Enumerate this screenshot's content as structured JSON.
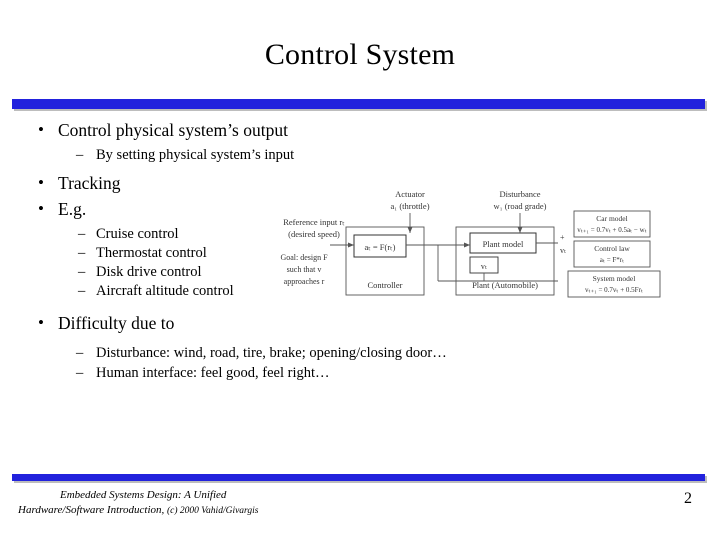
{
  "slide": {
    "title": "Control System",
    "page_number": "2",
    "accent_color": "#2222dd",
    "bullets": {
      "b1_1": "Control physical system’s output",
      "b2_1": "By setting physical system’s input",
      "b1_2": "Tracking",
      "b1_3": "E.g.",
      "b2_2": "Cruise control",
      "b2_3": "Thermostat control",
      "b2_4": "Disk drive control",
      "b2_5": "Aircraft altitude control",
      "b1_4": "Difficulty due to",
      "b2_6": "Disturbance: wind, road, tire, brake; opening/closing door…",
      "b2_7": "Human interface: feel good, feel right…"
    },
    "diagram": {
      "actuator_label_1": "Actuator",
      "actuator_label_2": "a₁ (throttle)",
      "disturbance_label_1": "Disturbance",
      "disturbance_label_2": "w₁ (road grade)",
      "reference_label_1": "Reference input rₜ",
      "reference_label_2": "(desired speed)",
      "goal_label_1": "Goal: design F",
      "goal_label_2": "such that v",
      "goal_label_3": "approaches r",
      "controller_box": "Controller",
      "formula_box": "aₜ = F(rₜ)",
      "plant_box": "Plant model",
      "plant_inner": "vₜ",
      "plant_auto_box": "Plant (Automobile)",
      "car_model_title": "Car model",
      "car_model_eq": "vₜ₊₁ = 0.7vₜ + 0.5aₜ − wₜ",
      "control_law_title": "Control law",
      "control_law_eq": "aₜ = F*rₜ",
      "system_model_title": "System model",
      "system_model_eq": "vₜ₊₁ = 0.7vₜ + 0.5Frₜ",
      "sum_symbol": "+",
      "output_symbol": "vₜ"
    },
    "footer": {
      "line1": "Embedded Systems Design: A Unified",
      "line2": "Hardware/Software Introduction,",
      "line2_rest": "(c) 2000 Vahid/Givargis"
    }
  }
}
